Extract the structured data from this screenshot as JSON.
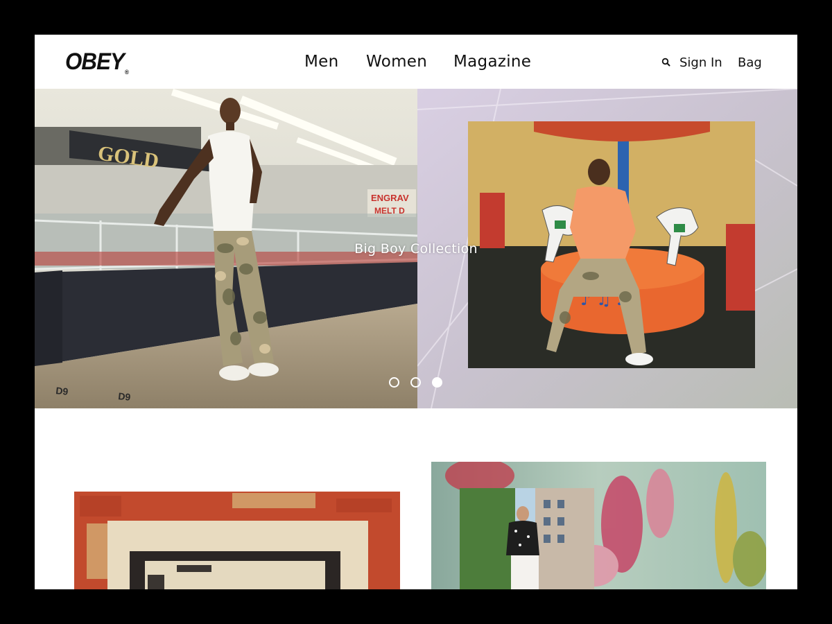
{
  "header": {
    "logo": "OBEY",
    "logo_mark": "®",
    "nav": [
      "Men",
      "Women",
      "Magazine"
    ],
    "sign_in": "Sign In",
    "bag": "Bag",
    "search_icon": "search-icon"
  },
  "hero": {
    "caption": "Big Boy Collection",
    "slide_count": 3,
    "active_slide": 3
  },
  "colors": {
    "accent": "#111111",
    "background": "#ffffff",
    "frame": "#000000"
  }
}
